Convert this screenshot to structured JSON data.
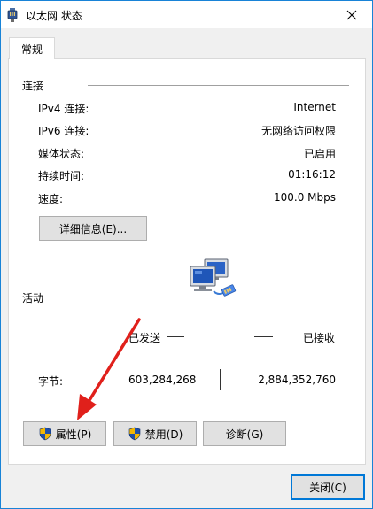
{
  "window": {
    "title": "以太网 状态"
  },
  "tabs": [
    {
      "label": "常规"
    }
  ],
  "connection": {
    "title": "连接",
    "rows": [
      {
        "label": "IPv4 连接:",
        "value": "Internet"
      },
      {
        "label": "IPv6 连接:",
        "value": "无网络访问权限"
      },
      {
        "label": "媒体状态:",
        "value": "已启用"
      },
      {
        "label": "持续时间:",
        "value": "01:16:12"
      },
      {
        "label": "速度:",
        "value": "100.0 Mbps"
      }
    ],
    "details_button": "详细信息(E)..."
  },
  "activity": {
    "title": "活动",
    "sent_label": "已发送",
    "received_label": "已接收",
    "bytes_label": "字节:",
    "bytes_sent": "603,284,268",
    "bytes_received": "2,884,352,760"
  },
  "buttons": {
    "properties": "属性(P)",
    "disable": "禁用(D)",
    "diagnose": "诊断(G)",
    "close": "关闭(C)"
  },
  "icons": {
    "title": "network-adapter-icon",
    "close": "close-icon",
    "shield": "uac-shield-icon",
    "computers": "network-computers-icon"
  },
  "colors": {
    "accent": "#0078d7",
    "annotation_arrow": "#e0201b"
  }
}
